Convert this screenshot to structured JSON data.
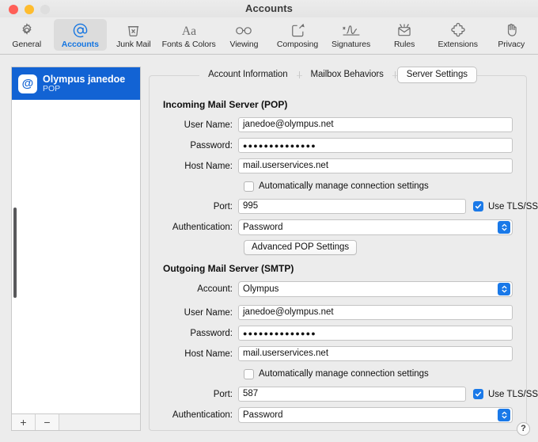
{
  "window": {
    "title": "Accounts",
    "traffic": {
      "close": "close-button",
      "minimize": "minimize-button",
      "zoom": "zoom-button"
    }
  },
  "toolbar": {
    "items": [
      {
        "label": "General",
        "icon": "gear-icon",
        "selected": false
      },
      {
        "label": "Accounts",
        "icon": "at-sign-icon",
        "selected": true
      },
      {
        "label": "Junk Mail",
        "icon": "trash-icon",
        "selected": false
      },
      {
        "label": "Fonts & Colors",
        "icon": "font-aa-icon",
        "selected": false
      },
      {
        "label": "Viewing",
        "icon": "glasses-icon",
        "selected": false
      },
      {
        "label": "Composing",
        "icon": "compose-icon",
        "selected": false
      },
      {
        "label": "Signatures",
        "icon": "signature-icon",
        "selected": false
      },
      {
        "label": "Rules",
        "icon": "rules-icon",
        "selected": false
      },
      {
        "label": "Extensions",
        "icon": "puzzle-icon",
        "selected": false
      },
      {
        "label": "Privacy",
        "icon": "hand-icon",
        "selected": false
      }
    ]
  },
  "sidebar": {
    "account": {
      "badge": "@",
      "name": "Olympus janedoe",
      "type": "POP"
    },
    "footer": {
      "add_label": "+",
      "remove_label": "−"
    }
  },
  "tabs": [
    {
      "label": "Account Information",
      "active": false
    },
    {
      "label": "Mailbox Behaviors",
      "active": false
    },
    {
      "label": "Server Settings",
      "active": true
    }
  ],
  "incoming": {
    "title": "Incoming Mail Server (POP)",
    "user_name_label": "User Name:",
    "user_name_value": "janedoe@olympus.net",
    "password_label": "Password:",
    "password_value": "●●●●●●●●●●●●●●",
    "host_name_label": "Host Name:",
    "host_name_value": "mail.userservices.net",
    "auto_manage_label": "Automatically manage connection settings",
    "auto_manage_checked": false,
    "port_label": "Port:",
    "port_value": "995",
    "tls_label": "Use TLS/SSL",
    "tls_checked": true,
    "auth_label": "Authentication:",
    "auth_value": "Password",
    "advanced_button": "Advanced POP Settings"
  },
  "outgoing": {
    "title": "Outgoing Mail Server (SMTP)",
    "account_label": "Account:",
    "account_value": "Olympus",
    "user_name_label": "User Name:",
    "user_name_value": "janedoe@olympus.net",
    "password_label": "Password:",
    "password_value": "●●●●●●●●●●●●●●",
    "host_name_label": "Host Name:",
    "host_name_value": "mail.userservices.net",
    "auto_manage_label": "Automatically manage connection settings",
    "auto_manage_checked": false,
    "port_label": "Port:",
    "port_value": "587",
    "tls_label": "Use TLS/SSL",
    "tls_checked": true,
    "auth_label": "Authentication:",
    "auth_value": "Password"
  },
  "help": {
    "label": "?"
  },
  "colors": {
    "accent": "#1a79e8",
    "selection": "#1263d4",
    "window_bg": "#ececec",
    "field_bg": "#ffffff"
  }
}
